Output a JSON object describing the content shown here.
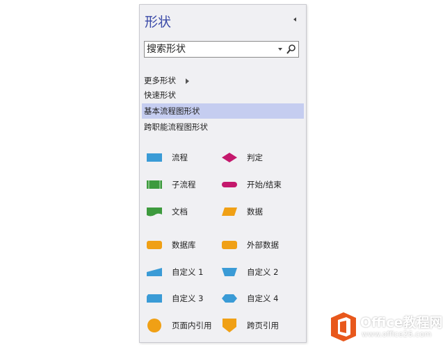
{
  "panel": {
    "title": "形状",
    "search": {
      "placeholder": "搜索形状",
      "value": ""
    },
    "categories": [
      {
        "label": "更多形状",
        "has_submenu": true,
        "selected": false
      },
      {
        "label": "快速形状",
        "selected": false
      },
      {
        "label": "基本流程图形状",
        "selected": true
      },
      {
        "label": "跨职能流程图形状",
        "selected": false
      }
    ],
    "shapes": [
      {
        "label": "流程",
        "icon": "process-shape-icon",
        "color": "#3a9bd6"
      },
      {
        "label": "判定",
        "icon": "decision-shape-icon",
        "color": "#c4186c"
      },
      {
        "label": "子流程",
        "icon": "subprocess-shape-icon",
        "color": "#3d9a3d"
      },
      {
        "label": "开始/结束",
        "icon": "start-end-shape-icon",
        "color": "#c4186c"
      },
      {
        "label": "文档",
        "icon": "document-shape-icon",
        "color": "#3d9a3d"
      },
      {
        "label": "数据",
        "icon": "data-shape-icon",
        "color": "#f0a015"
      },
      {
        "label": "数据库",
        "icon": "database-shape-icon",
        "color": "#f0a015"
      },
      {
        "label": "外部数据",
        "icon": "external-data-shape-icon",
        "color": "#f0a015"
      },
      {
        "label": "自定义 1",
        "icon": "custom1-shape-icon",
        "color": "#3a9bd6"
      },
      {
        "label": "自定义 2",
        "icon": "custom2-shape-icon",
        "color": "#3a9bd6"
      },
      {
        "label": "自定义 3",
        "icon": "custom3-shape-icon",
        "color": "#3a9bd6"
      },
      {
        "label": "自定义 4",
        "icon": "custom4-shape-icon",
        "color": "#3a9bd6"
      },
      {
        "label": "页面内引用",
        "icon": "on-page-reference-icon",
        "color": "#f0a015"
      },
      {
        "label": "跨页引用",
        "icon": "off-page-reference-icon",
        "color": "#f0a015"
      }
    ]
  },
  "watermark": {
    "brand": "Office教程网",
    "url": "www.office26.com",
    "color": "#e8581c"
  }
}
